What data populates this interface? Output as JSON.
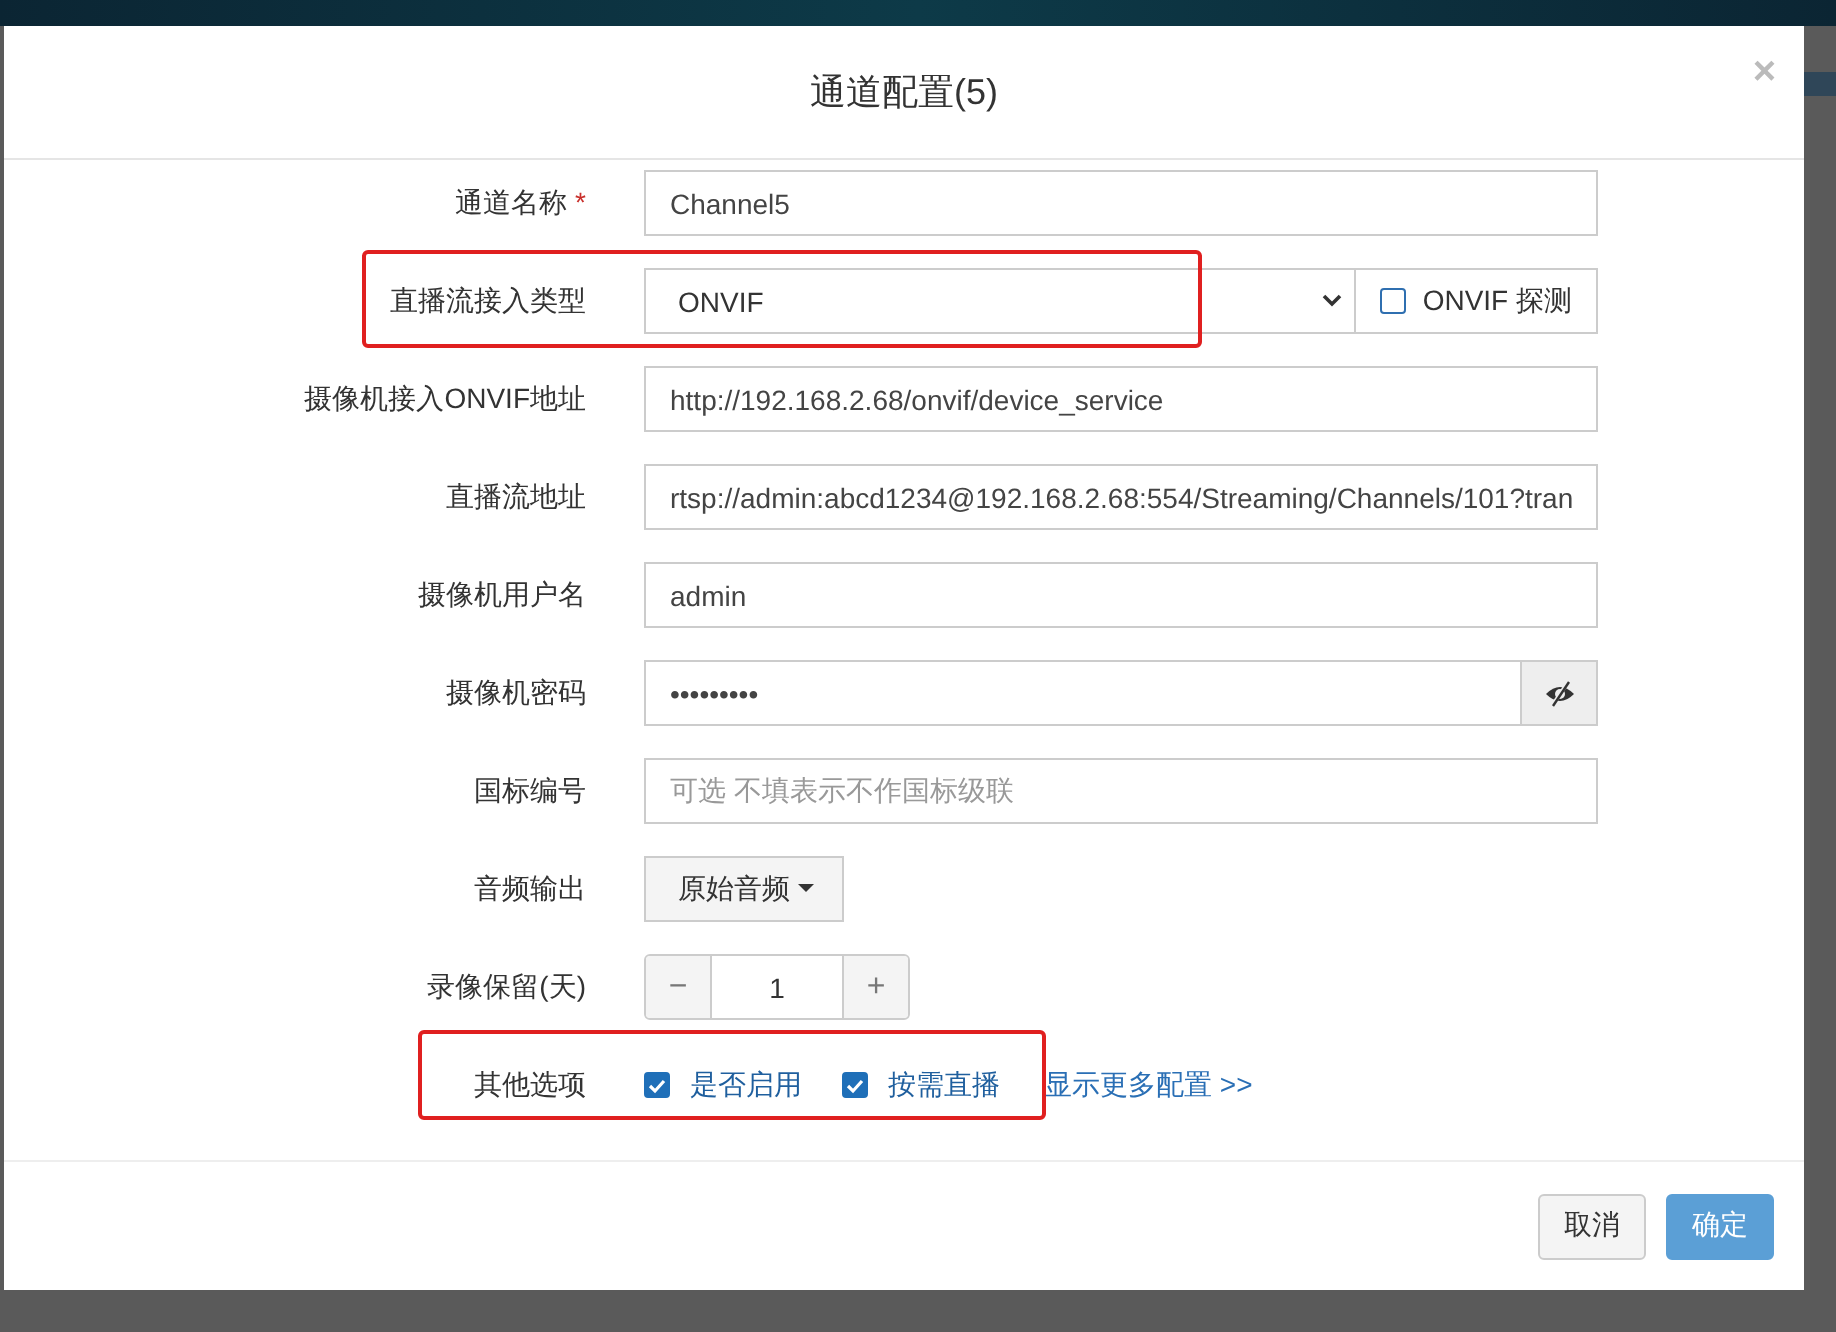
{
  "dialog": {
    "title": "通道配置(5)",
    "close": "×"
  },
  "fields": [
    {
      "kind": "text",
      "label": "通道名称",
      "required_mark": "*",
      "value": "Channel5",
      "highlighted": false
    },
    {
      "kind": "select",
      "label": "直播流接入类型",
      "value": "ONVIF",
      "highlighted": true,
      "probe": {
        "label": "ONVIF 探测",
        "checked": false
      }
    },
    {
      "kind": "text",
      "label": "摄像机接入ONVIF地址",
      "value": "http://192.168.2.68/onvif/device_service",
      "highlighted": false
    },
    {
      "kind": "text",
      "label": "直播流地址",
      "value": "rtsp://admin:abcd1234@192.168.2.68:554/Streaming/Channels/101?tran",
      "highlighted": false
    },
    {
      "kind": "text",
      "label": "摄像机用户名",
      "value": "admin",
      "highlighted": false
    },
    {
      "kind": "password",
      "label": "摄像机密码",
      "value": "•••••••••",
      "highlighted": false
    },
    {
      "kind": "text",
      "label": "国标编号",
      "placeholder": "可选 不填表示不作国标级联",
      "highlighted": false
    },
    {
      "kind": "dropdown",
      "label": "音频输出",
      "value": "原始音频",
      "highlighted": false
    },
    {
      "kind": "stepper",
      "label": "录像保留(天)",
      "value": "1",
      "minus": "−",
      "plus": "+",
      "highlighted": false
    },
    {
      "kind": "options",
      "label": "其他选项",
      "highlighted": true,
      "options": [
        {
          "label": "是否启用",
          "checked": true
        },
        {
          "label": "按需直播",
          "checked": true
        }
      ],
      "link": "显示更多配置 >>"
    }
  ],
  "buttons": [
    {
      "label": "取消",
      "kind": "default"
    },
    {
      "label": "确定",
      "kind": "primary"
    }
  ]
}
